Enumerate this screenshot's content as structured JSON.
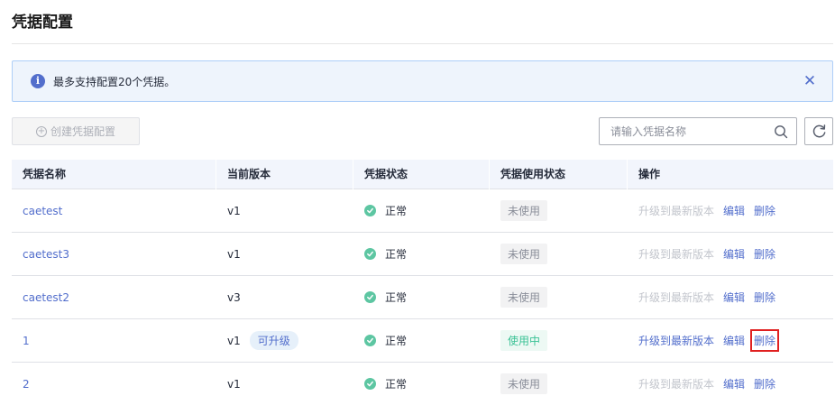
{
  "page": {
    "title": "凭据配置"
  },
  "alert": {
    "text": "最多支持配置20个凭据。",
    "icon": "info-icon",
    "close_icon": "close-icon"
  },
  "toolbar": {
    "create_label": "创建凭据配置",
    "search_placeholder": "请输入凭据名称",
    "search_value": ""
  },
  "table": {
    "headers": [
      "凭据名称",
      "当前版本",
      "凭据状态",
      "凭据使用状态",
      "操作"
    ],
    "rows": [
      {
        "name": "caetest",
        "version": "v1",
        "badge": "",
        "status": "正常",
        "usage": "未使用",
        "in_use": false,
        "ops": {
          "upgrade": "升级到最新版本",
          "upgrade_enabled": false,
          "edit": "编辑",
          "delete": "删除"
        }
      },
      {
        "name": "caetest3",
        "version": "v1",
        "badge": "",
        "status": "正常",
        "usage": "未使用",
        "in_use": false,
        "ops": {
          "upgrade": "升级到最新版本",
          "upgrade_enabled": false,
          "edit": "编辑",
          "delete": "删除"
        }
      },
      {
        "name": "caetest2",
        "version": "v3",
        "badge": "",
        "status": "正常",
        "usage": "未使用",
        "in_use": false,
        "ops": {
          "upgrade": "升级到最新版本",
          "upgrade_enabled": false,
          "edit": "编辑",
          "delete": "删除"
        }
      },
      {
        "name": "1",
        "version": "v1",
        "badge": "可升级",
        "status": "正常",
        "usage": "使用中",
        "in_use": true,
        "ops": {
          "upgrade": "升级到最新版本",
          "upgrade_enabled": true,
          "edit": "编辑",
          "delete": "删除"
        }
      },
      {
        "name": "2",
        "version": "v1",
        "badge": "",
        "status": "正常",
        "usage": "未使用",
        "in_use": false,
        "ops": {
          "upgrade": "升级到最新版本",
          "upgrade_enabled": false,
          "edit": "编辑",
          "delete": "删除"
        }
      }
    ]
  },
  "colors": {
    "link": "#526ecc",
    "status_ok": "#5dc6a2",
    "in_use": "#3ac295",
    "highlight": "#e02020"
  }
}
